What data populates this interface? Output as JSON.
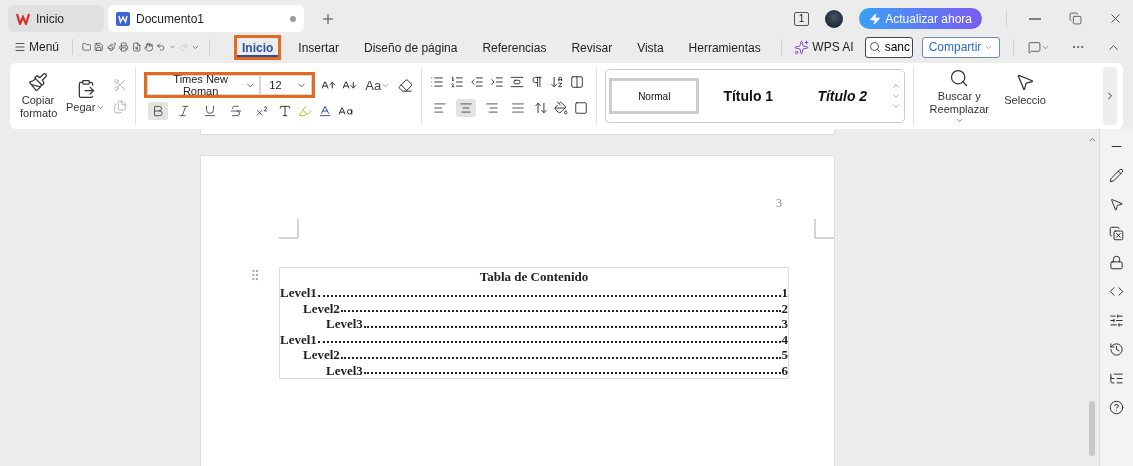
{
  "window_tabs": [
    {
      "label": "Inicio",
      "kind": "home",
      "selected": false
    },
    {
      "label": "Documento1",
      "kind": "document",
      "selected": true
    }
  ],
  "title_bar": {
    "page_count": "1",
    "upgrade_button": "Actualizar ahora"
  },
  "menu_bar": {
    "menu_label": "Menú",
    "ribbon_tabs": [
      {
        "label": "Inicio",
        "selected": true,
        "highlighted": true
      },
      {
        "label": "Insertar",
        "selected": false,
        "highlighted": false
      },
      {
        "label": "Diseño de página",
        "selected": false,
        "highlighted": false
      },
      {
        "label": "Referencias",
        "selected": false,
        "highlighted": false
      },
      {
        "label": "Revisar",
        "selected": false,
        "highlighted": false
      },
      {
        "label": "Vista",
        "selected": false,
        "highlighted": false
      },
      {
        "label": "Herramientas",
        "selected": false,
        "highlighted": false
      }
    ],
    "ai_button": "WPS AI",
    "search": {
      "value": "sanc"
    },
    "share_button": "Compartir"
  },
  "ribbon": {
    "copy_format": "Copiar formato",
    "paste": "Pegar",
    "font": {
      "name": "Times New Roman",
      "size": "12",
      "highlighted": true
    },
    "change_case": "Aa",
    "text_formats": [
      {
        "kind": "bold",
        "active": true
      },
      {
        "kind": "italic",
        "active": false
      },
      {
        "kind": "underline",
        "active": false
      },
      {
        "kind": "strike",
        "active": false
      },
      {
        "kind": "superscript",
        "active": false
      }
    ],
    "alignments": [
      {
        "kind": "left",
        "selected": false
      },
      {
        "kind": "center",
        "selected": true
      },
      {
        "kind": "right",
        "selected": false
      },
      {
        "kind": "justify",
        "selected": false
      }
    ],
    "styles": [
      {
        "label": "Normal",
        "kind": "normal",
        "selected": true
      },
      {
        "label": "Título 1",
        "kind": "heading1",
        "selected": false
      },
      {
        "label": "Título 2",
        "kind": "heading2",
        "selected": false
      }
    ],
    "find_replace": "Buscar y Reemplazar",
    "select": "Seleccio"
  },
  "document": {
    "page_number": "3",
    "toc": {
      "title": "Tabla de Contenido",
      "entries": [
        {
          "label": "Level1",
          "page": "1",
          "children": [
            {
              "label": "Level2",
              "page": "2",
              "children": [
                {
                  "label": "Level3",
                  "page": "3"
                }
              ]
            }
          ]
        },
        {
          "label": "Level1",
          "page": "4",
          "children": [
            {
              "label": "Level2",
              "page": "5",
              "children": [
                {
                  "label": "Level3",
                  "page": "6"
                }
              ]
            }
          ]
        }
      ]
    }
  }
}
